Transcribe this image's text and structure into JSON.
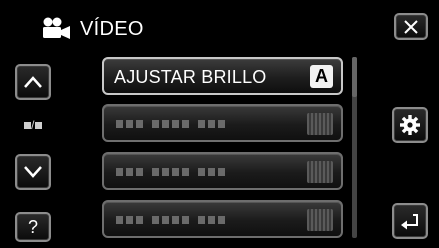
{
  "header": {
    "title": "VÍDEO",
    "icon": "video-camera-icon"
  },
  "close_button": {
    "icon": "close-x-icon"
  },
  "nav": {
    "up_icon": "chevron-up-icon",
    "down_icon": "chevron-down-icon",
    "page_indicator": "/",
    "help_label": "?"
  },
  "menu_items": [
    {
      "label": "AJUSTAR BRILLO",
      "value_badge": "A",
      "selected": true
    },
    {
      "label": "",
      "value_badge": ""
    },
    {
      "label": "",
      "value_badge": ""
    },
    {
      "label": "",
      "value_badge": ""
    }
  ],
  "side_buttons": {
    "settings_icon": "gear-icon",
    "back_icon": "return-arrow-icon"
  },
  "colors": {
    "background": "#000000",
    "border": "#8c8c8c",
    "text": "#ffffff",
    "badge": "#f2f2f2"
  }
}
